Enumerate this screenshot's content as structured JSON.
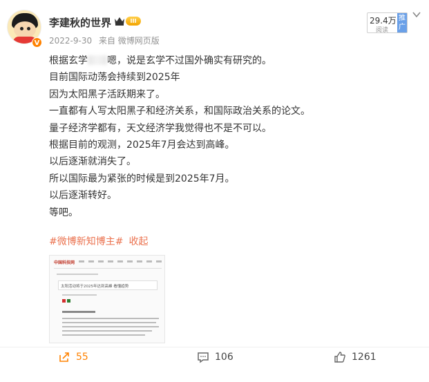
{
  "author": {
    "name": "李建秋的世界",
    "verified_badge": "V",
    "level_badge": "III"
  },
  "meta": {
    "date": "2022-9-30",
    "source": "来自 微博网页版"
  },
  "rank_badge": {
    "count": "29.4万",
    "sub": "阅读",
    "tag": "推广"
  },
  "post": {
    "line1_a": "根据玄学",
    "line1_b": "嗯，说是玄学不过国外确实有研究的。",
    "lines": [
      "目前国际动荡会持续到2025年",
      "因为太阳黑子活跃期来了。",
      "一直都有人写太阳黑子和经济关系，和国际政治关系的论文。",
      "量子经济学都有，天文经济学我觉得也不是不可以。",
      "根据目前的观测，2025年7月会达到高峰。",
      "以后逐渐就消失了。",
      "所以国际最为紧张的时候是到2025年7月。",
      "以后逐渐转好。",
      "等吧。"
    ],
    "tag": "#微博新知博主#",
    "collapse": "收起"
  },
  "thumbnail": {
    "logo": "中国科技网",
    "headline": "太阳活动将于2025年达到高峰 看懂趋势"
  },
  "actions": {
    "forward_count": "55",
    "comment_count": "106",
    "like_count": "1261"
  },
  "colors": {
    "accent": "#ff8200",
    "tag": "#eb7350",
    "meta": "#939393"
  },
  "icons": [
    "forward-icon",
    "comment-icon",
    "like-icon",
    "chevron-down-icon",
    "crown-icon"
  ]
}
